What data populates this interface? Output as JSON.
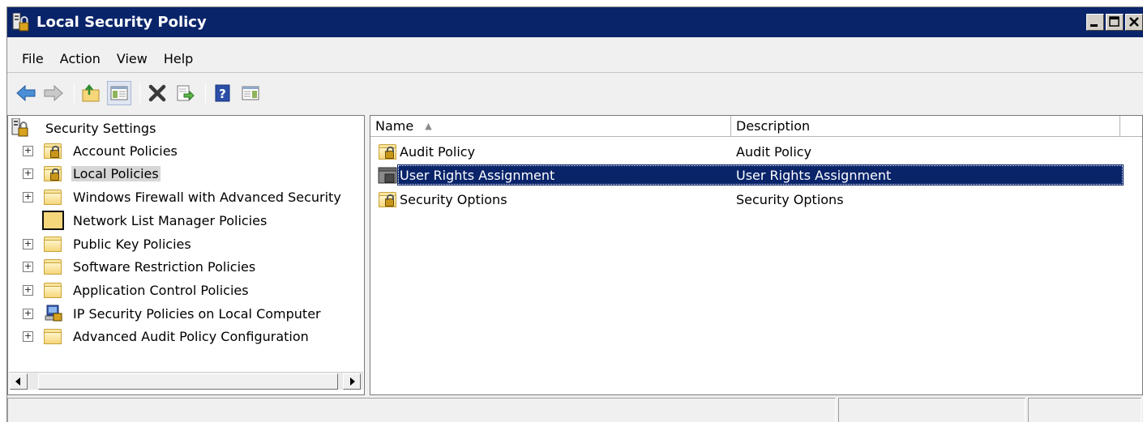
{
  "window": {
    "title": "Local Security Policy",
    "title_icon": "security-policy-icon",
    "buttons": [
      "minimize",
      "maximize",
      "close"
    ]
  },
  "menu": {
    "items": [
      {
        "label": "File"
      },
      {
        "label": "Action"
      },
      {
        "label": "View"
      },
      {
        "label": "Help"
      }
    ]
  },
  "toolbar": {
    "tools": [
      "back-icon",
      "forward-icon",
      "up-folder-icon",
      "show-hide-tree-icon",
      "delete-icon",
      "export-list-icon",
      "help-icon",
      "properties-icon"
    ]
  },
  "tree": {
    "root": {
      "label": "Security Settings",
      "icon": "security-settings-icon"
    },
    "items": [
      {
        "label": "Account Policies",
        "expandable": true,
        "icon": "locked-folder-icon"
      },
      {
        "label": "Local Policies",
        "expandable": true,
        "icon": "locked-folder-icon",
        "selected": true
      },
      {
        "label": "Windows Firewall with Advanced Security",
        "expandable": true,
        "icon": "folder-icon"
      },
      {
        "label": "Network List Manager Policies",
        "expandable": false,
        "icon": "folder-icon"
      },
      {
        "label": "Public Key Policies",
        "expandable": true,
        "icon": "folder-icon"
      },
      {
        "label": "Software Restriction Policies",
        "expandable": true,
        "icon": "folder-icon"
      },
      {
        "label": "Application Control Policies",
        "expandable": true,
        "icon": "folder-icon"
      },
      {
        "label": "IP Security Policies on Local Computer",
        "expandable": true,
        "icon": "ip-security-icon"
      },
      {
        "label": "Advanced Audit Policy Configuration",
        "expandable": true,
        "icon": "folder-icon"
      }
    ]
  },
  "list": {
    "columns": {
      "name": "Name",
      "description": "Description",
      "sort_indicator": "▲"
    },
    "rows": [
      {
        "name": "Audit Policy",
        "description": "Audit Policy",
        "selected": false
      },
      {
        "name": "User Rights Assignment",
        "description": "User Rights Assignment",
        "selected": true
      },
      {
        "name": "Security Options",
        "description": "Security Options",
        "selected": false
      }
    ]
  },
  "colors": {
    "titlebar": "#0a246a",
    "selection": "#0a246a",
    "folder": "#f0c95a"
  }
}
